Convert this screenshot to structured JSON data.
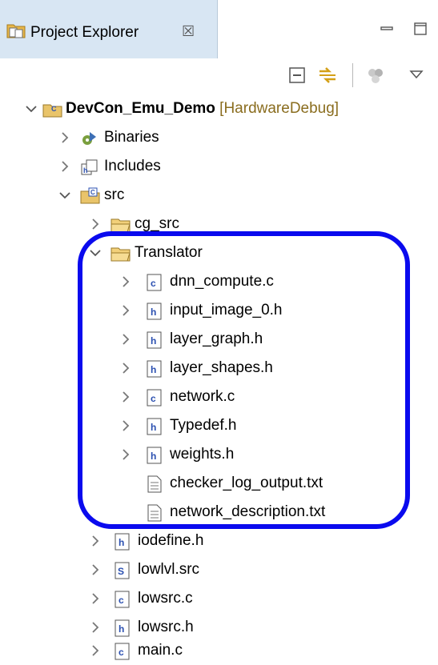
{
  "view": {
    "tab_title": "Project Explorer",
    "close_glyph": "☒",
    "buttons": [
      "minimize-icon",
      "maximize-icon"
    ]
  },
  "toolbar": {
    "items": [
      "collapse-all-icon",
      "link-with-editor-icon",
      "view-filter-icon",
      "view-menu-icon"
    ]
  },
  "tree": [
    {
      "label": "DevCon_Emu_Demo",
      "decoration": "[HardwareDebug]",
      "expanded": true,
      "icon": "c-project-icon"
    },
    {
      "label": "Binaries",
      "expanded": false,
      "icon": "binaries-icon"
    },
    {
      "label": "Includes",
      "expanded": false,
      "icon": "includes-icon"
    },
    {
      "label": "src",
      "expanded": true,
      "icon": "source-folder-icon"
    },
    {
      "label": "cg_src",
      "expanded": false,
      "icon": "folder-icon"
    },
    {
      "label": "Translator",
      "expanded": true,
      "icon": "folder-icon"
    },
    {
      "label": "dnn_compute.c",
      "expanded": false,
      "icon": "c-file-icon"
    },
    {
      "label": "input_image_0.h",
      "expanded": false,
      "icon": "h-file-icon"
    },
    {
      "label": "layer_graph.h",
      "expanded": false,
      "icon": "h-file-icon"
    },
    {
      "label": "layer_shapes.h",
      "expanded": false,
      "icon": "h-file-icon"
    },
    {
      "label": "network.c",
      "expanded": false,
      "icon": "c-file-icon"
    },
    {
      "label": "Typedef.h",
      "expanded": false,
      "icon": "h-file-icon"
    },
    {
      "label": "weights.h",
      "expanded": false,
      "icon": "h-file-icon"
    },
    {
      "label": "checker_log_output.txt",
      "icon": "text-file-icon"
    },
    {
      "label": "network_description.txt",
      "icon": "text-file-icon"
    },
    {
      "label": "iodefine.h",
      "expanded": false,
      "icon": "h-file-icon"
    },
    {
      "label": "lowlvl.src",
      "expanded": false,
      "icon": "asm-file-icon"
    },
    {
      "label": "lowsrc.c",
      "expanded": false,
      "icon": "c-file-icon"
    },
    {
      "label": "lowsrc.h",
      "expanded": false,
      "icon": "h-file-icon"
    },
    {
      "label": "main.c",
      "expanded": false,
      "icon": "c-file-icon"
    }
  ],
  "annotation": {
    "color": "#0a0aee"
  }
}
